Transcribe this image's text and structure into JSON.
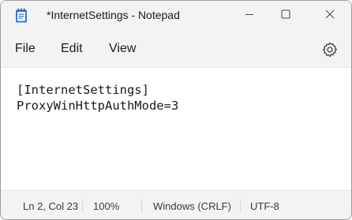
{
  "window": {
    "title": "*InternetSettings - Notepad"
  },
  "menu": {
    "file": "File",
    "edit": "Edit",
    "view": "View"
  },
  "icons": {
    "app": "notepad-icon",
    "minimize": "minimize-icon",
    "maximize": "maximize-icon",
    "close": "close-icon",
    "settings": "gear-icon"
  },
  "editor": {
    "lines": [
      "[InternetSettings]",
      "ProxyWinHttpAuthMode=3"
    ]
  },
  "status": {
    "position": "Ln 2, Col 23",
    "zoom": "100%",
    "line_ending": "Windows (CRLF)",
    "encoding": "UTF-8"
  },
  "colors": {
    "chrome": "#f3f3f3",
    "accent": "#2b7cd3"
  }
}
